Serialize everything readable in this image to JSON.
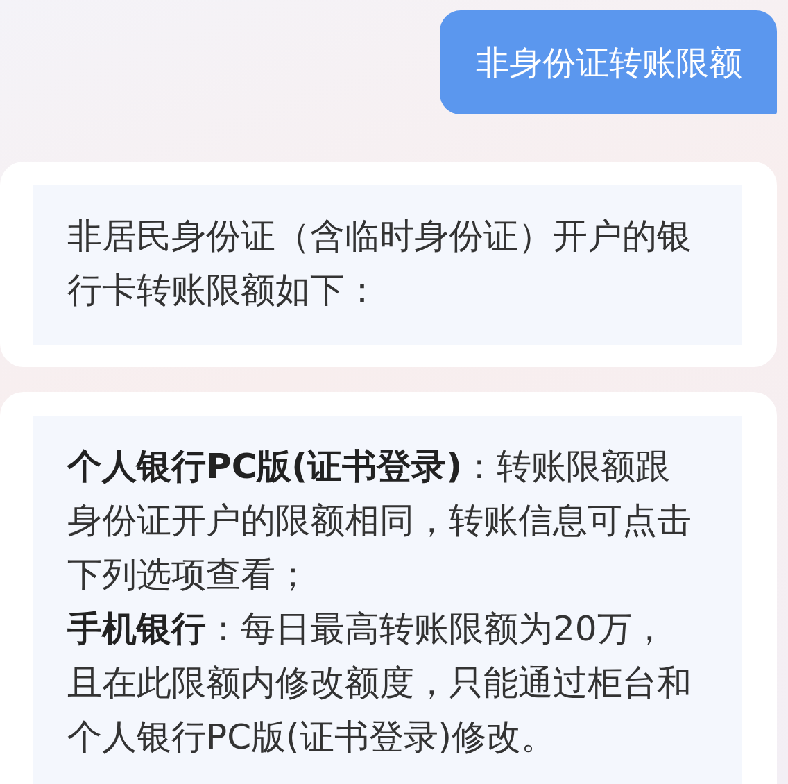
{
  "messages": [
    {
      "kind": "user",
      "text": "非身份证转账限额"
    },
    {
      "kind": "bot",
      "paragraphs": [
        "非居民身份证（含临时身份证）开户的银行卡转账限额如下："
      ]
    },
    {
      "kind": "bot",
      "paragraphs": [
        "**个人银行PC版(证书登录)**：转账限额跟身份证开户的限额相同，转账信息可点击下列选项查看；",
        "**手机银行**：每日最高转账限额为20万，且在此限额内修改额度，只能通过柜台和个人银行PC版(证书登录)修改。"
      ]
    }
  ]
}
